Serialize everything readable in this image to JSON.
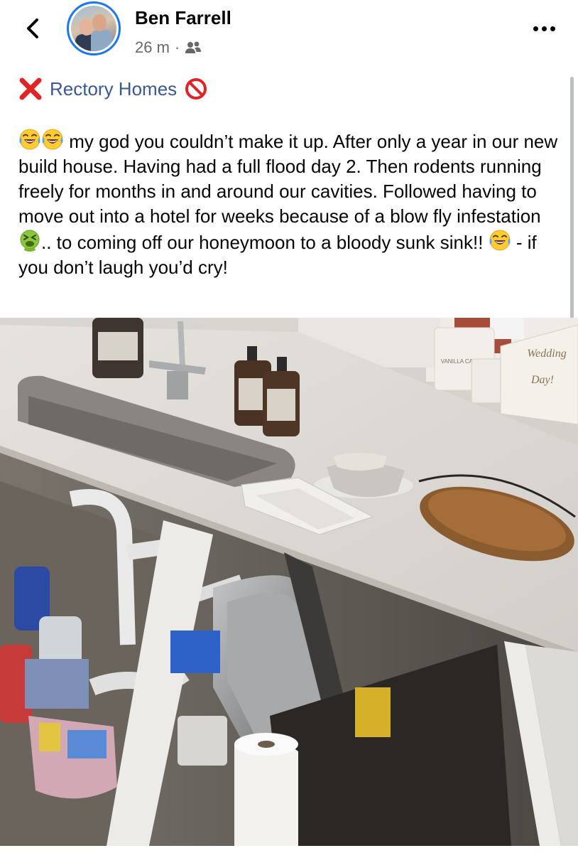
{
  "post": {
    "author_name": "Ben Farrell",
    "time_ago": "26 m",
    "separator": "·",
    "title_link": "Rectory Homes",
    "body_text_1": "my god you couldn’t make it up. After only a year in our new build house. Having had a full flood day 2. Then rodents running freely for months in and around our cavities. Followed having to move out into a hotel for weeks because of a blow fly infestation ",
    "body_text_2": ".. to coming off our honeymoon to a bloody sunk sink!! ",
    "body_text_3": " - if you don’t laugh you’d cry!"
  },
  "photo": {
    "candle_label": "VANILLA CANDLE",
    "card_text_1": "Wedding",
    "card_text_2": "Day!"
  },
  "icons": {
    "back": "chevron-left-icon",
    "more": "more-horizontal-icon",
    "audience": "friends-icon",
    "cross": "cross-mark-emoji",
    "prohibited": "prohibited-emoji",
    "laugh": "tears-of-joy-emoji",
    "sick": "vomiting-face-emoji"
  },
  "colors": {
    "accent": "#1877f2",
    "link": "#385898",
    "secondary_text": "#65676b"
  }
}
